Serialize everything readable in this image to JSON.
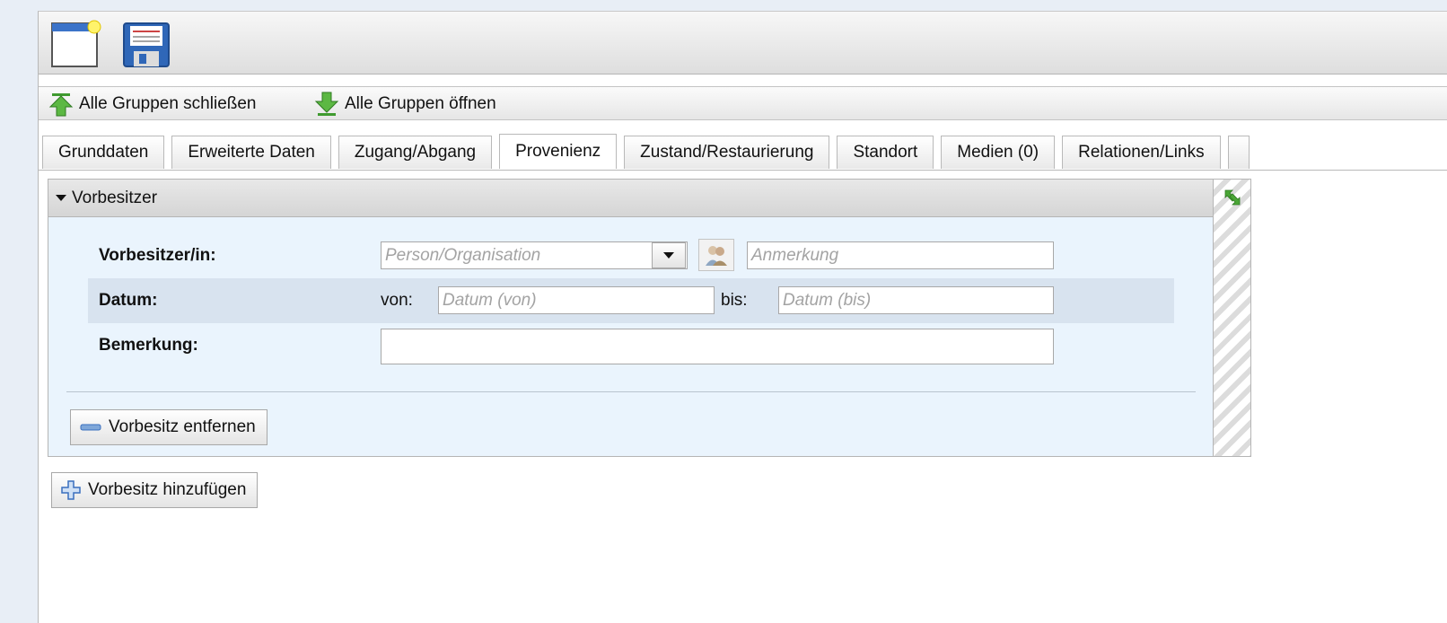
{
  "toolbar": {
    "new_icon": "new-document-icon",
    "save_icon": "floppy-disk-icon"
  },
  "groupbar": {
    "close_all": "Alle Gruppen schließen",
    "open_all": "Alle Gruppen öffnen"
  },
  "tabs": [
    {
      "label": "Grunddaten"
    },
    {
      "label": "Erweiterte Daten"
    },
    {
      "label": "Zugang/Abgang"
    },
    {
      "label": "Provenienz",
      "active": true
    },
    {
      "label": "Zustand/Restaurierung"
    },
    {
      "label": "Standort"
    },
    {
      "label": "Medien (0)"
    },
    {
      "label": "Relationen/Links"
    },
    {
      "label": ""
    }
  ],
  "group": {
    "title": "Vorbesitzer",
    "owner_label": "Vorbesitzer/in:",
    "owner_placeholder": "Person/Organisation",
    "note_placeholder": "Anmerkung",
    "date_label": "Datum:",
    "from_label": "von:",
    "from_placeholder": "Datum (von)",
    "to_label": "bis:",
    "to_placeholder": "Datum (bis)",
    "remark_label": "Bemerkung:",
    "remark_value": "",
    "remove_button": "Vorbesitz entfernen"
  },
  "add_button": "Vorbesitz hinzufügen",
  "colors": {
    "panel_bg": "#eaf4fd",
    "alt_row": "#d8e3ef",
    "accent_green": "#3f9a2f",
    "accent_blue": "#3a6fbe"
  }
}
